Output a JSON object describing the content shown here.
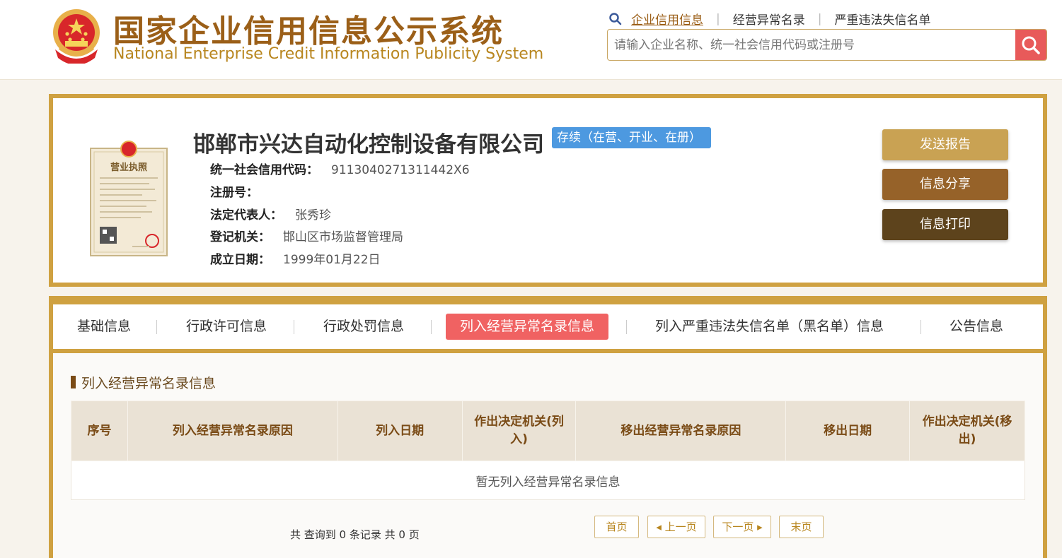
{
  "header": {
    "title_cn": "国家企业信用信息公示系统",
    "title_en": "National Enterprise Credit Information Publicity System",
    "nav": [
      {
        "label": "企业信用信息"
      },
      {
        "label": "经营异常名录"
      },
      {
        "label": "严重违法失信名单"
      }
    ],
    "search_placeholder": "请输入企业名称、统一社会信用代码或注册号"
  },
  "company": {
    "name": "邯郸市兴达自动化控制设备有限公司",
    "status": "存续（在营、开业、在册）",
    "fields": [
      {
        "label": "统一社会信用代码：",
        "value": "9113040271311442X6"
      },
      {
        "label": "注册号：",
        "value": ""
      },
      {
        "label": "法定代表人：",
        "value": "张秀珍"
      },
      {
        "label": "登记机关：",
        "value": "邯山区市场监督管理局"
      },
      {
        "label": "成立日期：",
        "value": "1999年01月22日"
      }
    ],
    "actions": {
      "send": "发送报告",
      "share": "信息分享",
      "print": "信息打印"
    },
    "license_text": "营业执照"
  },
  "tabs": [
    {
      "label": "基础信息"
    },
    {
      "label": "行政许可信息"
    },
    {
      "label": "行政处罚信息"
    },
    {
      "label": "列入经营异常名录信息"
    },
    {
      "label": "列入严重违法失信名单（黑名单）信息"
    },
    {
      "label": "公告信息"
    }
  ],
  "section": {
    "title": "列入经营异常名录信息",
    "columns": [
      {
        "label": "序号"
      },
      {
        "label": "列入经营异常名录原因"
      },
      {
        "label": "列入日期"
      },
      {
        "label": "作出决定机关(列入)"
      },
      {
        "label": "移出经营异常名录原因"
      },
      {
        "label": "移出日期"
      },
      {
        "label": "作出决定机关(移出)"
      }
    ],
    "empty_text": "暂无列入经营异常名录信息"
  },
  "pagination": {
    "summary": "共 查询到 0 条记录 共 0 页",
    "first": "首页",
    "prev": "上一页",
    "next": "下一页",
    "last": "末页"
  },
  "colors": {
    "accent_gold": "#cfa141",
    "brand_brown": "#9b5f18",
    "active_tab": "#f06262",
    "status_blue": "#4d99e0"
  }
}
